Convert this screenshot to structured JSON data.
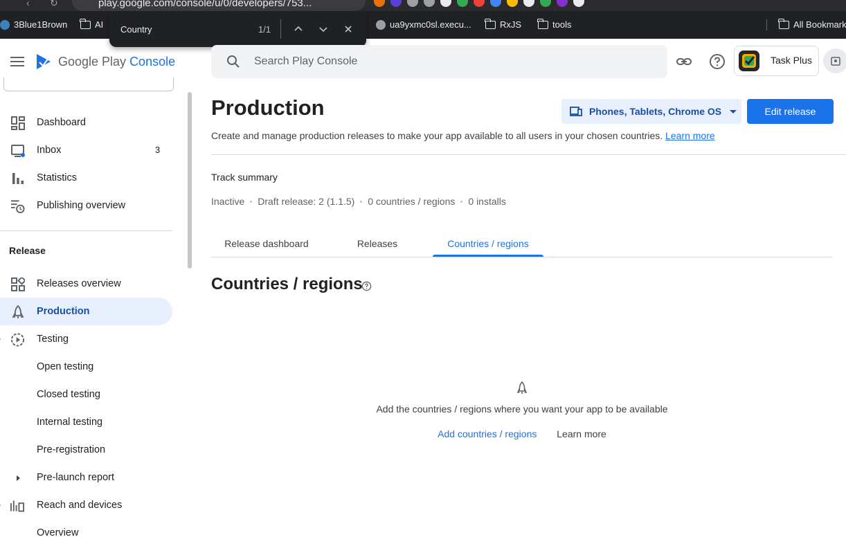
{
  "browser": {
    "url": "play.google.com/console/u/0/developers/753...",
    "bookmarks": [
      {
        "label": "3Blue1Brown",
        "kind": "site"
      },
      {
        "label": "AI",
        "kind": "folder"
      },
      {
        "label": "ua9yxmc0sl.execu...",
        "kind": "site"
      },
      {
        "label": "RxJS",
        "kind": "folder"
      },
      {
        "label": "tools",
        "kind": "folder"
      },
      {
        "label": "All Bookmarks",
        "kind": "folder"
      }
    ],
    "find_bar": {
      "query": "Country",
      "count": "1/1",
      "prev_icon": "chevron-up-icon",
      "next_icon": "chevron-down-icon",
      "close_icon": "close-icon"
    }
  },
  "header": {
    "brand_prefix": "Google Play ",
    "brand_suffix": "Console",
    "search_placeholder": "Search Play Console",
    "app_name": "Task Plus",
    "colors": {
      "accent": "#1a73e8",
      "active_bg": "#e8f0fe"
    }
  },
  "sidebar": {
    "items": [
      {
        "label": "Dashboard",
        "icon": "dashboard-icon"
      },
      {
        "label": "Inbox",
        "icon": "inbox-icon",
        "badge": "3"
      },
      {
        "label": "Statistics",
        "icon": "bar-chart-icon"
      },
      {
        "label": "Publishing overview",
        "icon": "publishing-icon"
      }
    ],
    "section_label": "Release",
    "release_items": [
      {
        "label": "Releases overview",
        "icon": "releases-overview-icon"
      },
      {
        "label": "Production",
        "icon": "production-icon",
        "active": true
      },
      {
        "label": "Testing",
        "icon": "testing-icon"
      },
      {
        "label": "Open testing"
      },
      {
        "label": "Closed testing"
      },
      {
        "label": "Internal testing"
      },
      {
        "label": "Pre-registration"
      },
      {
        "label": "Pre-launch report",
        "icon": "expand-arrow-icon"
      },
      {
        "label": "Reach and devices",
        "icon": "reach-chart-icon"
      },
      {
        "label": "Overview"
      }
    ]
  },
  "main": {
    "title": "Production",
    "device_button": "Phones, Tablets, Chrome OS",
    "edit_button": "Edit release",
    "subtitle": "Create and manage production releases to make your app available to all users in your chosen countries.",
    "learn_more": "Learn more",
    "track_summary": {
      "title": "Track summary",
      "status": "Inactive",
      "draft_release": "Draft release: 2 (1.1.5)",
      "countries": "0 countries / regions",
      "installs": "0 installs"
    },
    "tabs": [
      {
        "label": "Release dashboard"
      },
      {
        "label": "Releases"
      },
      {
        "label": "Countries / regions",
        "active": true
      }
    ],
    "section_title": "Countries / regions",
    "empty_state": {
      "text": "Add the countries / regions where you want your app to be available",
      "primary_link": "Add countries / regions",
      "secondary_link": "Learn more"
    }
  }
}
